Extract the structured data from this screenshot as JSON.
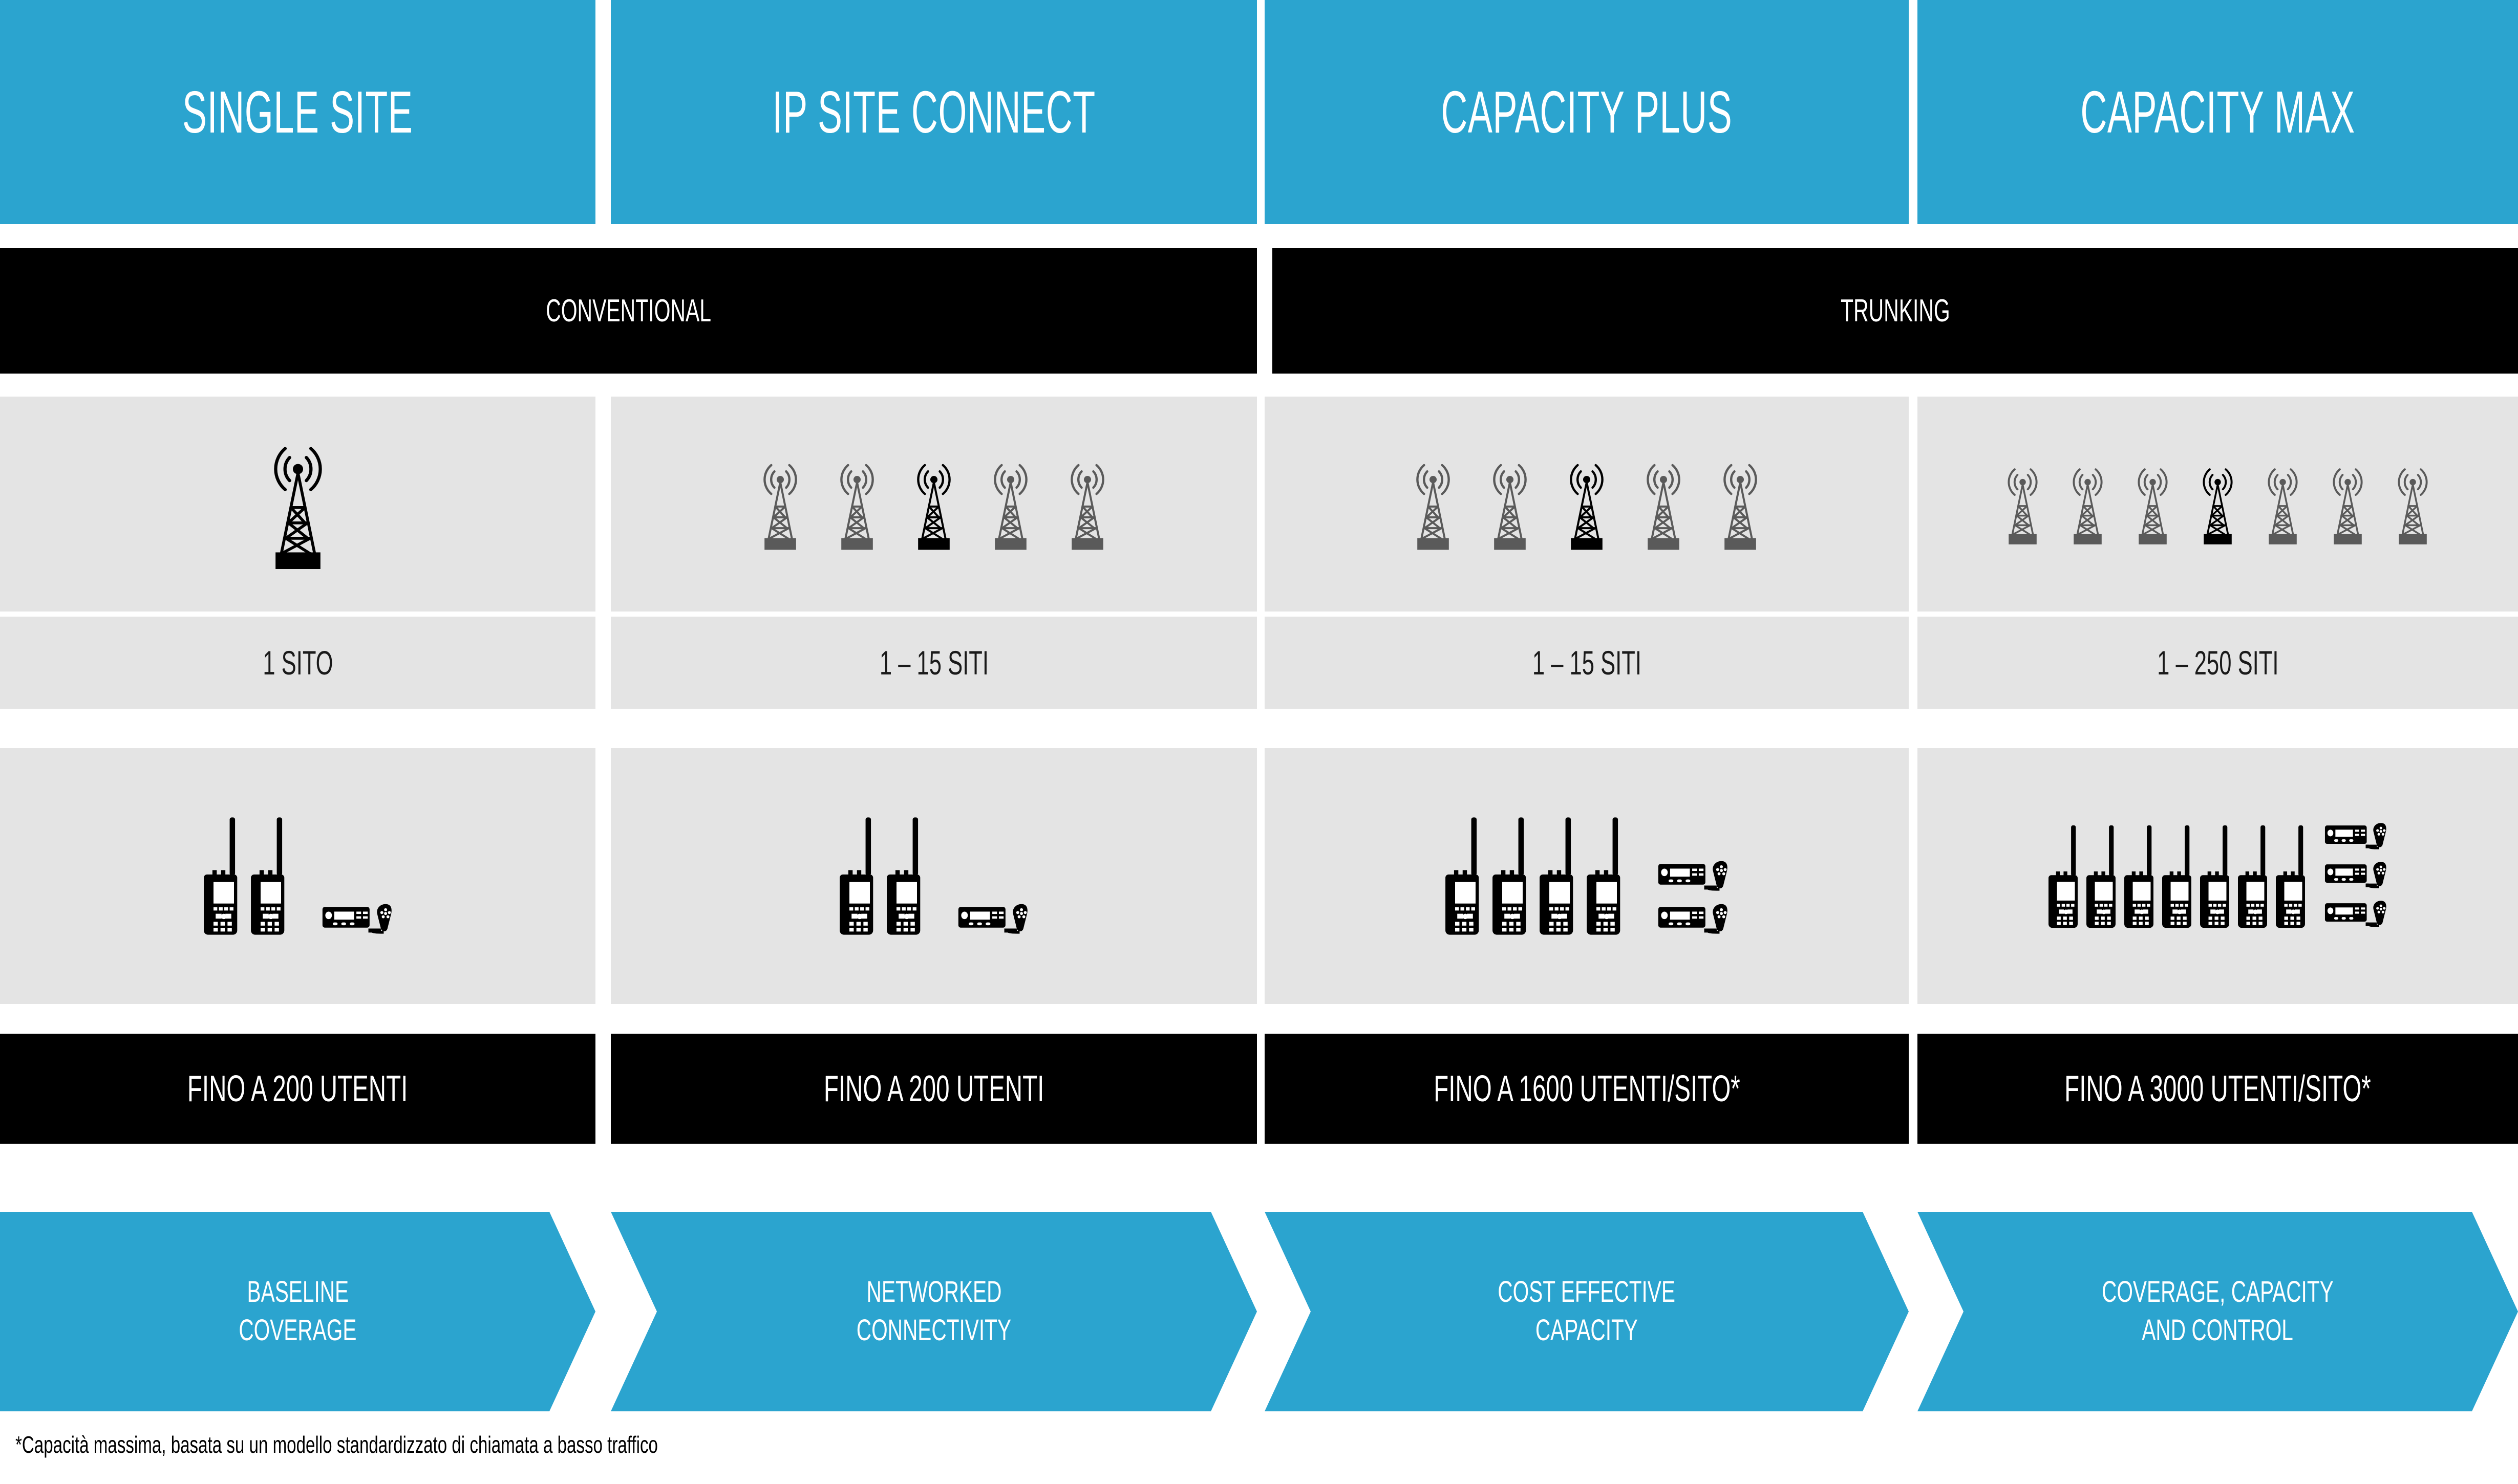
{
  "columns": [
    {
      "id": "single-site",
      "title": "SINGLE SITE",
      "sites": "1 SITO",
      "users": "FINO A 200 UTENTI",
      "benefit_line1": "BASELINE",
      "benefit_line2": "COVERAGE",
      "towers_total": 1,
      "towers_highlight_index": 0,
      "portables": 2,
      "mobiles": 1
    },
    {
      "id": "ip-site-connect",
      "title": "IP SITE CONNECT",
      "sites": "1 – 15 SITI",
      "users": "FINO A 200 UTENTI",
      "benefit_line1": "NETWORKED",
      "benefit_line2": "CONNECTIVITY",
      "towers_total": 5,
      "towers_highlight_index": 2,
      "portables": 2,
      "mobiles": 1
    },
    {
      "id": "capacity-plus",
      "title": "CAPACITY PLUS",
      "sites": "1 – 15 SITI",
      "users": "FINO A 1600 UTENTI/SITO*",
      "benefit_line1": "COST EFFECTIVE",
      "benefit_line2": "CAPACITY",
      "towers_total": 5,
      "towers_highlight_index": 2,
      "portables": 4,
      "mobiles": 2
    },
    {
      "id": "capacity-max",
      "title": "CAPACITY MAX",
      "sites": "1 – 250 SITI",
      "users": "FINO A 3000 UTENTI/SITO*",
      "benefit_line1": "COVERAGE, CAPACITY",
      "benefit_line2": "AND CONTROL",
      "towers_total": 7,
      "towers_highlight_index": 3,
      "portables": 7,
      "mobiles": 3
    }
  ],
  "bands": {
    "conventional": "CONVENTIONAL",
    "trunking": "TRUNKING"
  },
  "footnote": "*Capacità massima, basata su un modello standardizzato di chiamata a basso traffico",
  "colors": {
    "accent_blue": "#2ba4cf",
    "band_black": "#000000",
    "panel_gray": "#e4e4e4",
    "tower_gray": "#5a5a5a",
    "tower_black": "#000000",
    "text_white": "#ffffff",
    "text_black": "#1a1a1a"
  },
  "icons": {
    "tower": "radio-tower-icon",
    "portable": "portable-radio-icon",
    "mobile": "mobile-radio-icon"
  }
}
